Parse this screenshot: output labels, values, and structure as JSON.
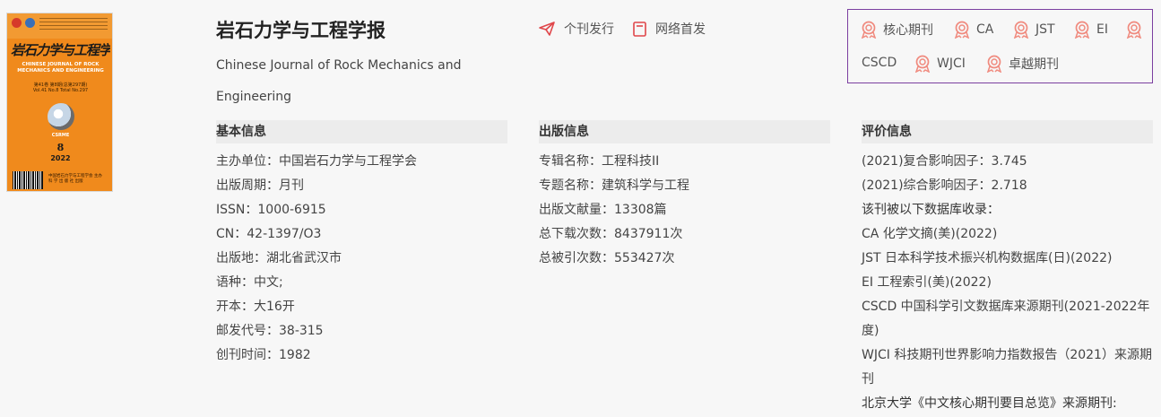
{
  "journal": {
    "title": "岩石力学与工程学报",
    "english_title": "Chinese Journal of Rock Mechanics and Engineering"
  },
  "cover": {
    "cn_title": "岩石力学与工程学报",
    "en_title": "CHINESE JOURNAL OF ROCK MECHANICS AND ENGINEERING",
    "volume_line": "第41卷 第8期(总第297期)",
    "volume_line_en": "Vol.41 No.8 Total No.297",
    "society_abbr": "CSRME",
    "issue_number": "8",
    "year": "2022",
    "publisher_line": "中国岩石力学与工程学会 主办",
    "publisher_line_2": "科 学 出 版 社 出版"
  },
  "flags": [
    {
      "label": "个刊发行",
      "icon": "paper-plane-icon"
    },
    {
      "label": "网络首发",
      "icon": "document-icon"
    }
  ],
  "badges": [
    {
      "label": "核心期刊",
      "icon": "award-ribbon-icon"
    },
    {
      "label": "CA",
      "icon": "award-ribbon-icon"
    },
    {
      "label": "JST",
      "icon": "award-ribbon-icon"
    },
    {
      "label": "EI",
      "icon": "award-ribbon-icon"
    },
    {
      "label": "CSCD",
      "icon": "award-ribbon-icon"
    },
    {
      "label": "WJCI",
      "icon": "award-ribbon-icon"
    },
    {
      "label": "卓越期刊",
      "icon": "award-ribbon-icon"
    }
  ],
  "basic": {
    "heading": "基本信息",
    "rows": [
      {
        "k": "主办单位：",
        "v": "中国岩石力学与工程学会"
      },
      {
        "k": "出版周期：",
        "v": "月刊"
      },
      {
        "k": "ISSN：",
        "v": "1000-6915"
      },
      {
        "k": "CN：",
        "v": "42-1397/O3"
      },
      {
        "k": "出版地：",
        "v": "湖北省武汉市"
      },
      {
        "k": "语种：",
        "v": "中文;"
      },
      {
        "k": "开本：",
        "v": "大16开"
      },
      {
        "k": "邮发代号：",
        "v": "38-315"
      },
      {
        "k": "创刊时间：",
        "v": "1982"
      }
    ]
  },
  "publication": {
    "heading": "出版信息",
    "rows": [
      {
        "k": "专辑名称：",
        "v": "工程科技II"
      },
      {
        "k": "专题名称：",
        "v": "建筑科学与工程"
      },
      {
        "k": "出版文献量：",
        "v": "13308篇"
      },
      {
        "k": "总下载次数：",
        "v": "8437911次"
      },
      {
        "k": "总被引次数：",
        "v": "553427次"
      }
    ]
  },
  "evaluation": {
    "heading": "评价信息",
    "impact_composite": "(2021)复合影响因子：3.745",
    "impact_overall": "(2021)综合影响因子：2.718",
    "db_intro": "该刊被以下数据库收录：",
    "databases": [
      "CA 化学文摘(美)(2022)",
      "JST 日本科学技术振兴机构数据库(日)(2022)",
      "EI 工程索引(美)(2022)",
      "CSCD 中国科学引文数据库来源期刊(2021-2022年度)",
      "WJCI 科技期刊世界影响力指数报告（2021）来源期刊"
    ],
    "pku_line": "北京大学《中文核心期刊要目总览》来源期刊:"
  },
  "colors": {
    "badge_icon": "#f08a7e",
    "flag_icon": "#e0464a",
    "badge_border": "#7b3fa0",
    "cover_orange": "#f08a1c"
  }
}
